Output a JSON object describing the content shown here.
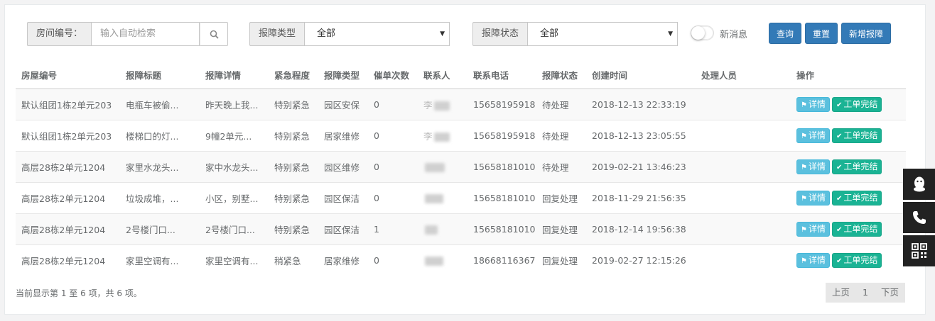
{
  "filters": {
    "room_label": "房间编号：",
    "room_placeholder": "输入自动检索",
    "type_label": "报障类型",
    "type_value": "全部",
    "status_label": "报障状态",
    "status_value": "全部",
    "new_msg_label": "新消息"
  },
  "buttons": {
    "query": "查询",
    "reset": "重置",
    "add": "新增报障"
  },
  "table": {
    "headers": [
      "房屋编号",
      "报障标题",
      "报障详情",
      "紧急程度",
      "报障类型",
      "催单次数",
      "联系人",
      "联系电话",
      "报障状态",
      "创建时间",
      "处理人员",
      "操作"
    ],
    "rows": [
      {
        "room": "默认组团1栋2单元203",
        "title": "电瓶车被偷...",
        "detail": "昨天晚上我...",
        "urgency": "特别紧急",
        "type": "园区安保",
        "reminders": "0",
        "contact_visible": "李",
        "phone": "15658195918",
        "status": "待处理",
        "created": "2018-12-13 22:33:19",
        "handler": ""
      },
      {
        "room": "默认组团1栋2单元203",
        "title": "楼梯口的灯...",
        "detail": "9幢2单元...",
        "urgency": "特别紧急",
        "type": "居家维修",
        "reminders": "0",
        "contact_visible": "李",
        "phone": "15658195918",
        "status": "待处理",
        "created": "2018-12-13 23:05:55",
        "handler": ""
      },
      {
        "room": "高层28栋2单元1204",
        "title": "家里水龙头...",
        "detail": "家中水龙头...",
        "urgency": "特别紧急",
        "type": "园区维修",
        "reminders": "0",
        "contact_visible": "",
        "phone": "15658181010",
        "status": "待处理",
        "created": "2019-02-21 13:46:23",
        "handler": ""
      },
      {
        "room": "高层28栋2单元1204",
        "title": "垃圾成堆，...",
        "detail": "小区，别墅...",
        "urgency": "特别紧急",
        "type": "园区保洁",
        "reminders": "0",
        "contact_visible": "",
        "phone": "15658181010",
        "status": "回复处理",
        "created": "2018-11-29 21:56:35",
        "handler": ""
      },
      {
        "room": "高层28栋2单元1204",
        "title": "2号楼门口...",
        "detail": "2号楼门口...",
        "urgency": "特别紧急",
        "type": "园区保洁",
        "reminders": "1",
        "contact_visible": "",
        "phone": "15658181010",
        "status": "回复处理",
        "created": "2018-12-14 19:56:38",
        "handler": ""
      },
      {
        "room": "高层28栋2单元1204",
        "title": "家里空调有...",
        "detail": "家里空调有...",
        "urgency": "稍紧急",
        "type": "居家维修",
        "reminders": "0",
        "contact_visible": "",
        "phone": "18668116367",
        "status": "回复处理",
        "created": "2019-02-27 12:15:26",
        "handler": ""
      }
    ],
    "action_detail": "详情",
    "action_complete": "工单完结"
  },
  "footer": {
    "summary": "当前显示第 1 至 6 项，共 6 项。",
    "prev": "上页",
    "page": "1",
    "next": "下页"
  },
  "colors": {
    "primary": "#337ab7",
    "info": "#5bc0de",
    "success": "#1ab394",
    "side_widget": "#222222"
  },
  "icons": {
    "search": "search-icon",
    "tag": "tag-icon",
    "check": "check-icon",
    "qq": "qq-icon",
    "phone": "phone-icon",
    "qrcode": "qrcode-icon"
  }
}
